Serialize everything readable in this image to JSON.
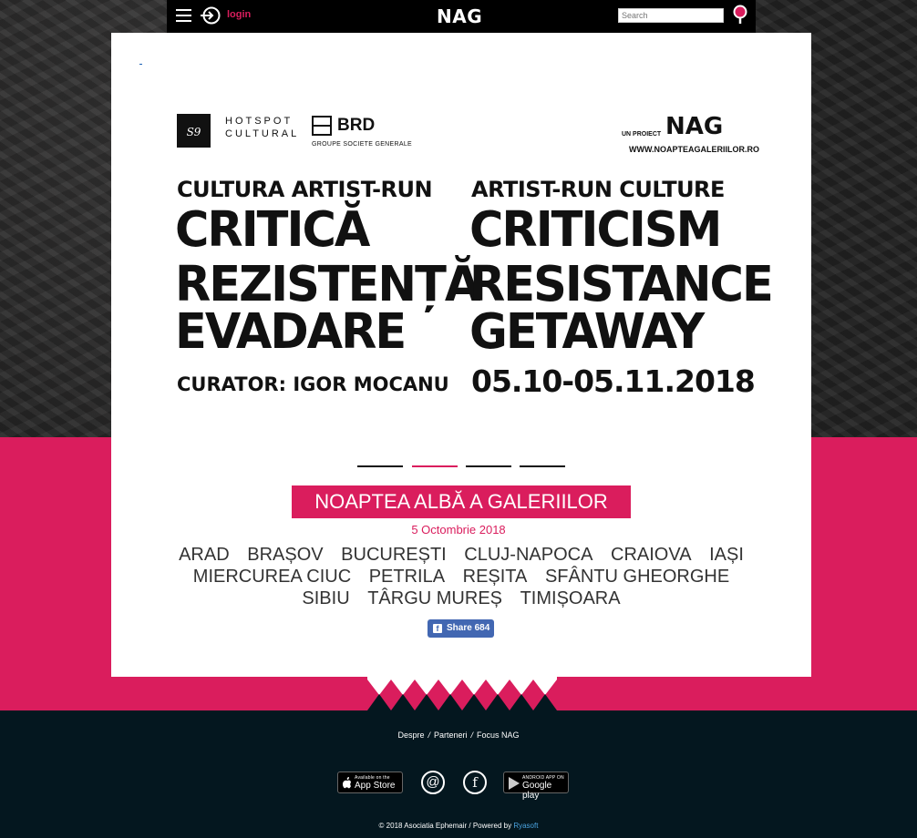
{
  "header": {
    "login_label": "login",
    "logo": "NAG",
    "search_placeholder": "Search"
  },
  "poster": {
    "partner_s9": "S9",
    "hotspot_line1": "HOTSPOT",
    "hotspot_line2": "CULTURAL",
    "brd": "BRD",
    "brd_sub": "GROUPE SOCIETE GENERALE",
    "un_proiect": "UN PROIECT",
    "nag": "NAG",
    "url": "WWW.NOAPTEAGALERIILOR.RO",
    "ro_subtitle": "CULTURA ARTIST-RUN",
    "ro_lines": [
      "CRITICĂ",
      "REZISTENȚĂ",
      "EVADARE"
    ],
    "curator": "CURATOR: IGOR MOCANU",
    "en_subtitle": "ARTIST-RUN CULTURE",
    "en_lines": [
      "CRITICISM",
      "RESISTANCE",
      "GETAWAY"
    ],
    "dates": "05.10-05.11.2018"
  },
  "carousel": {
    "count": 4,
    "active_index": 1
  },
  "event": {
    "title": "NOAPTEA ALBĂ A GALERIILOR",
    "date": "5 Octombrie 2018",
    "cities": [
      "ARAD",
      "BRAȘOV",
      "BUCUREȘTI",
      "CLUJ-NAPOCA",
      "CRAIOVA",
      "IAȘI",
      "MIERCUREA CIUC",
      "PETRILA",
      "REȘITA",
      "SFÂNTU GHEORGHE",
      "SIBIU",
      "TÂRGU MUREȘ",
      "TIMIȘOARA"
    ],
    "share_label": "Share 684"
  },
  "footer": {
    "links": [
      "Despre",
      "Parteneri",
      "Focus NAG"
    ],
    "appstore_small": "Available on the",
    "appstore_big": "App Store",
    "gplay_small": "ANDROID APP ON",
    "gplay_big": "Google play",
    "copyright_text": "© 2018 Asociatia Ephemair / Powered by ",
    "powered_by": "Ryasoft"
  },
  "colors": {
    "accent": "#da1d5d",
    "footer_bg": "#04171f",
    "topbar_bg": "#000000"
  }
}
